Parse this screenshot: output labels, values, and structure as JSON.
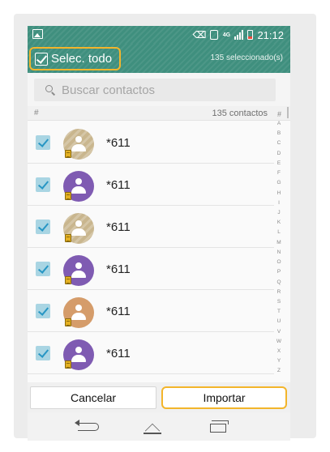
{
  "status_bar": {
    "time": "21:12",
    "icons": [
      "gallery-icon",
      "nfc-icon",
      "vibrate-icon",
      "lte-icon",
      "signal-icon",
      "battery-icon"
    ],
    "network_label": "4G"
  },
  "action_bar": {
    "select_all_label": "Selec. todo",
    "select_all_checked": true,
    "selected_count_label": "135 seleccionado(s)"
  },
  "search": {
    "placeholder": "Buscar contactos",
    "value": ""
  },
  "list_header": {
    "section_label": "#",
    "count_label": "135 contactos",
    "index_header": "#"
  },
  "contacts": [
    {
      "name": "*611",
      "checked": true,
      "avatar_color": "tan",
      "sim": true
    },
    {
      "name": "*611",
      "checked": true,
      "avatar_color": "purple",
      "sim": true
    },
    {
      "name": "*611",
      "checked": true,
      "avatar_color": "tan",
      "sim": true
    },
    {
      "name": "*611",
      "checked": true,
      "avatar_color": "purple",
      "sim": true
    },
    {
      "name": "*611",
      "checked": true,
      "avatar_color": "orange",
      "sim": true
    },
    {
      "name": "*611",
      "checked": true,
      "avatar_color": "purple",
      "sim": true
    }
  ],
  "alphabet_index": [
    "A",
    "B",
    "C",
    "D",
    "E",
    "F",
    "G",
    "H",
    "I",
    "J",
    "K",
    "L",
    "M",
    "N",
    "O",
    "P",
    "Q",
    "R",
    "S",
    "T",
    "U",
    "V",
    "W",
    "X",
    "Y",
    "Z"
  ],
  "buttons": {
    "cancel_label": "Cancelar",
    "import_label": "Importar"
  },
  "nav_bar": {
    "icons": [
      "back-icon",
      "home-icon",
      "recent-apps-icon"
    ]
  },
  "colors": {
    "header_teal": "#3f8f7e",
    "highlight_orange": "#f3b52b",
    "checkbox_blue": "#a9d5e3",
    "avatar_tan": "#c9b68e",
    "avatar_purple": "#7f5bb2",
    "avatar_orange": "#d59c6a"
  }
}
